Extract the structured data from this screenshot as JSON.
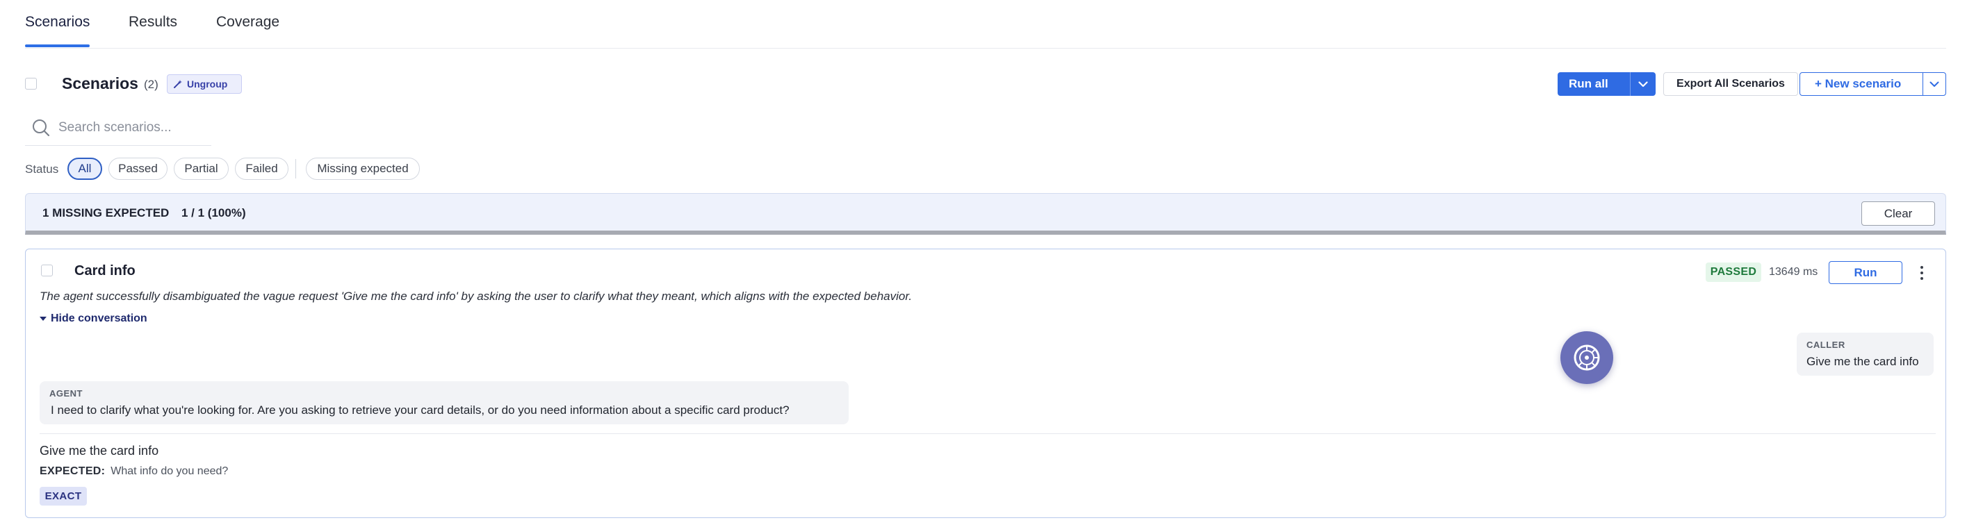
{
  "tabs": [
    {
      "label": "Scenarios",
      "active": true
    },
    {
      "label": "Results",
      "active": false
    },
    {
      "label": "Coverage",
      "active": false
    }
  ],
  "header": {
    "title": "Scenarios",
    "count": "(2)",
    "ungroup_label": "Ungroup",
    "run_all_label": "Run all",
    "export_label": "Export All Scenarios",
    "new_scenario_label": "+ New scenario"
  },
  "search": {
    "placeholder": "Search scenarios...",
    "value": ""
  },
  "filters": {
    "label": "Status",
    "options": [
      "All",
      "Passed",
      "Partial",
      "Failed"
    ],
    "selected": "All",
    "extra": "Missing expected"
  },
  "banner": {
    "title": "1 MISSING EXPECTED",
    "stats": "1 / 1 (100%)",
    "clear_label": "Clear"
  },
  "scenario": {
    "title": "Card info",
    "status": "PASSED",
    "duration": "13649 ms",
    "run_label": "Run",
    "summary": "The agent successfully disambiguated the vague request 'Give me the card info' by asking the user to clarify what they meant, which aligns with the expected behavior.",
    "toggle_label": "Hide conversation",
    "conversation": {
      "caller": {
        "role": "CALLER",
        "text": "Give me the card info"
      },
      "agent": {
        "role": "AGENT",
        "text": "I need to clarify what you're looking for. Are you asking to retrieve your card details, or do you need information about a specific card product?"
      }
    },
    "input": "Give me the card info",
    "expected_label": "EXPECTED:",
    "expected_value": "What info do you need?",
    "match_type": "EXACT"
  },
  "colors": {
    "accent": "#2f6be3",
    "passed_bg": "#e5f6ea",
    "passed_text": "#1e7a3c",
    "banner_bg": "#eef2fc"
  }
}
